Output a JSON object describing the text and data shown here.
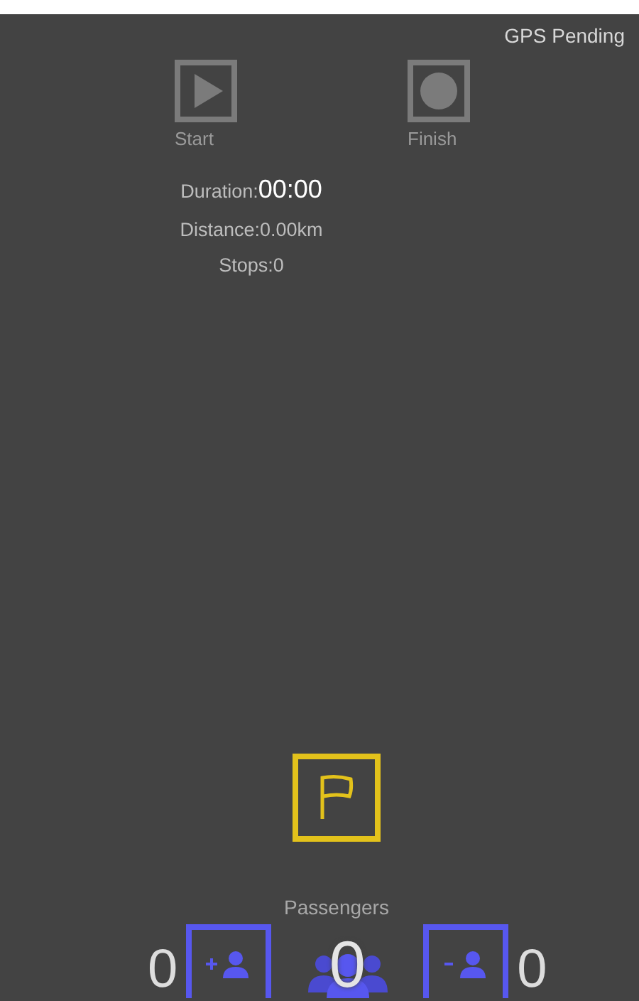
{
  "status": "GPS Pending",
  "controls": [
    {
      "kind": "start",
      "label": "Start",
      "disabled": true
    },
    {
      "kind": "finish",
      "label": "Finish",
      "disabled": true
    }
  ],
  "stats": [
    {
      "label": "Duration:",
      "value": "00:00"
    },
    {
      "label": "Distance:0.00km"
    },
    {
      "label": "Stops:0"
    }
  ],
  "passengers": {
    "title": "Passengers",
    "boarded": "0",
    "total": "0",
    "alighted": "0"
  }
}
